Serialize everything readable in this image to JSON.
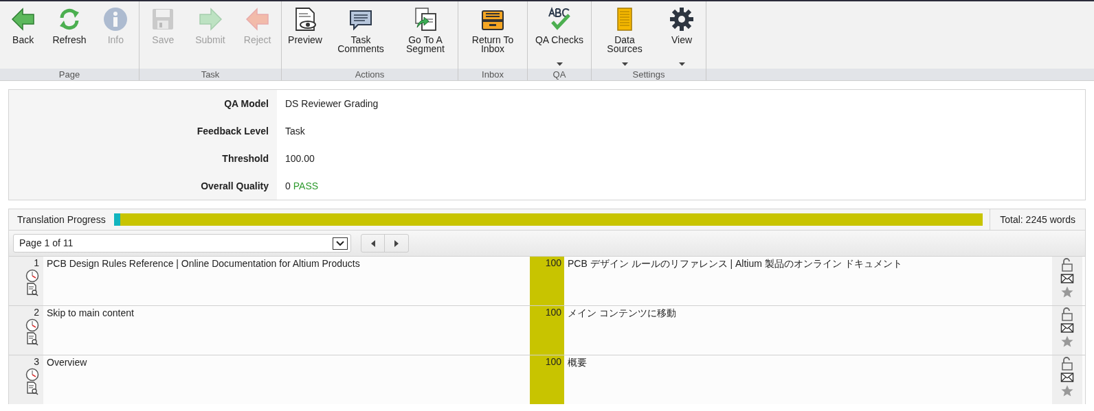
{
  "toolbar": {
    "groups": [
      {
        "label": "Page",
        "buttons": [
          {
            "kind": "back",
            "label": "Back",
            "disabled": false,
            "dropdown": false
          },
          {
            "kind": "refresh",
            "label": "Refresh",
            "disabled": false,
            "dropdown": false
          },
          {
            "kind": "info",
            "label": "Info",
            "disabled": true,
            "dropdown": false
          }
        ]
      },
      {
        "label": "Task",
        "buttons": [
          {
            "kind": "save",
            "label": "Save",
            "disabled": true,
            "dropdown": false
          },
          {
            "kind": "submit",
            "label": "Submit",
            "disabled": true,
            "dropdown": false
          },
          {
            "kind": "reject",
            "label": "Reject",
            "disabled": true,
            "dropdown": false
          }
        ]
      },
      {
        "label": "Actions",
        "buttons": [
          {
            "kind": "preview",
            "label": "Preview",
            "disabled": false,
            "dropdown": false
          },
          {
            "kind": "comments",
            "label": "Task Comments",
            "disabled": false,
            "dropdown": false
          },
          {
            "kind": "goto",
            "label": "Go To A Segment",
            "disabled": false,
            "dropdown": false
          }
        ]
      },
      {
        "label": "Inbox",
        "buttons": [
          {
            "kind": "inbox",
            "label": "Return To Inbox",
            "disabled": false,
            "dropdown": false
          }
        ]
      },
      {
        "label": "QA",
        "buttons": [
          {
            "kind": "qa",
            "label": "QA Checks",
            "disabled": false,
            "dropdown": true
          }
        ]
      },
      {
        "label": "Settings",
        "buttons": [
          {
            "kind": "datasources",
            "label": "Data Sources",
            "disabled": false,
            "dropdown": true
          },
          {
            "kind": "view",
            "label": "View",
            "disabled": false,
            "dropdown": true
          }
        ]
      }
    ]
  },
  "qa_info": [
    {
      "label": "QA Model",
      "value": "DS Reviewer Grading"
    },
    {
      "label": "Feedback Level",
      "value": "Task"
    },
    {
      "label": "Threshold",
      "value": "100.00"
    },
    {
      "label": "Overall Quality",
      "value": "0",
      "status": "PASS"
    }
  ],
  "progress": {
    "label": "Translation Progress",
    "segments": [
      {
        "level": 0.007,
        "color": "#12b5be"
      },
      {
        "level": 0.993,
        "color": "#c8c400"
      }
    ],
    "total": "Total: 2245 words"
  },
  "pager": {
    "value": "Page 1 of 11"
  },
  "segments": [
    {
      "number": "1",
      "source": "PCB Design Rules Reference | Online Documentation for Altium Products",
      "score": "100",
      "target": "PCB デザイン ルールのリファレンス | Altium 製品のオンライン ドキュメント"
    },
    {
      "number": "2",
      "source": "Skip to main content",
      "score": "100",
      "target": "メイン コンテンツに移動"
    },
    {
      "number": "3",
      "source": "Overview",
      "score": "100",
      "target": "概要"
    }
  ]
}
